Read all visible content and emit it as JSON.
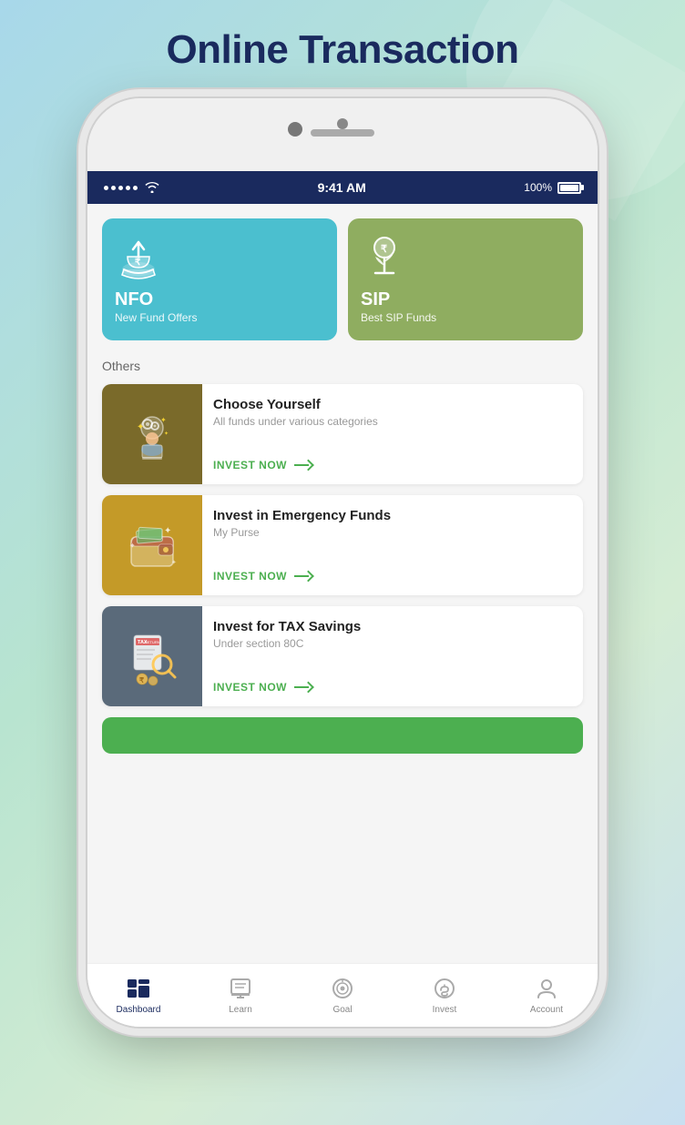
{
  "page": {
    "title": "Online Transaction",
    "background_hint": "Coul"
  },
  "status_bar": {
    "time": "9:41 AM",
    "battery": "100%",
    "signal_dots": 5
  },
  "fund_cards": [
    {
      "id": "nfo",
      "title": "NFO",
      "subtitle": "New Fund Offers",
      "color": "#4bbfcf",
      "icon": "nfo"
    },
    {
      "id": "sip",
      "title": "SIP",
      "subtitle": "Best SIP Funds",
      "color": "#8fad60",
      "icon": "sip"
    }
  ],
  "others_label": "Others",
  "list_cards": [
    {
      "id": "choose-yourself",
      "title": "Choose Yourself",
      "description": "All funds under various categories",
      "invest_label": "INVEST NOW",
      "icon": "person-thinking"
    },
    {
      "id": "emergency-funds",
      "title": "Invest in Emergency Funds",
      "description": "My Purse",
      "invest_label": "INVEST NOW",
      "icon": "purse"
    },
    {
      "id": "tax-savings",
      "title": "Invest for TAX Savings",
      "description": "Under section 80C",
      "invest_label": "INVEST NOW",
      "icon": "tax-return"
    }
  ],
  "bottom_nav": [
    {
      "id": "dashboard",
      "label": "Dashboard",
      "icon": "dashboard",
      "active": true
    },
    {
      "id": "learn",
      "label": "Learn",
      "icon": "learn",
      "active": false
    },
    {
      "id": "goal",
      "label": "Goal",
      "icon": "goal",
      "active": false
    },
    {
      "id": "invest",
      "label": "Invest",
      "icon": "invest",
      "active": false
    },
    {
      "id": "account",
      "label": "Account",
      "icon": "account",
      "active": false
    }
  ]
}
